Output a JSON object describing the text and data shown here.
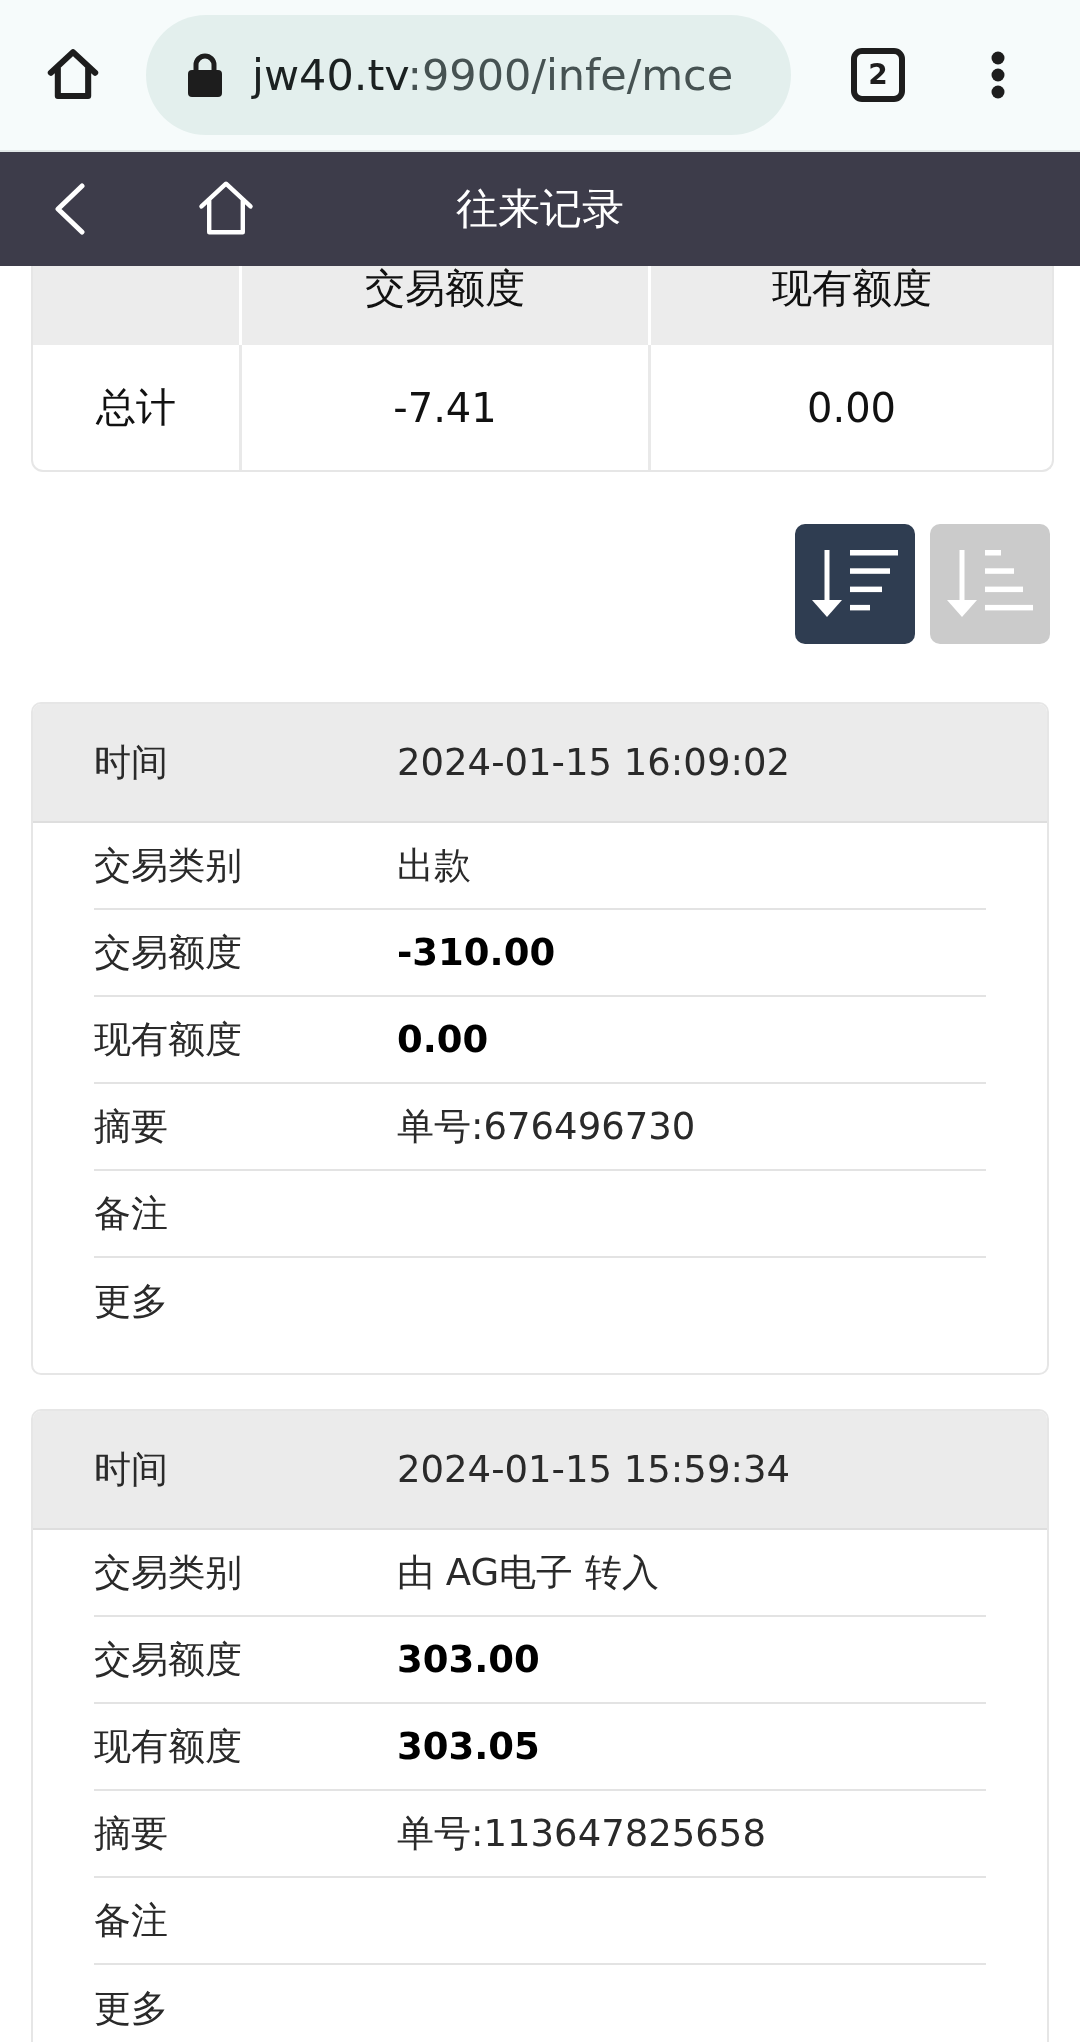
{
  "browser": {
    "url": {
      "host": "jw40.tv",
      "path": ":9900/infe/mce"
    },
    "tab_count": "2"
  },
  "header": {
    "title": "往来记录"
  },
  "summary": {
    "columns": [
      "交易额度",
      "现有额度"
    ],
    "rows": [
      {
        "label": "总计",
        "values": [
          "-7.41",
          "0.00"
        ]
      }
    ]
  },
  "sort_buttons": [
    {
      "kind": "descending",
      "selected": true
    },
    {
      "kind": "ascending",
      "selected": false
    }
  ],
  "records": [
    {
      "time_label": "时间",
      "time": "2024-01-15 16:09:02",
      "fields": [
        {
          "kind": "text",
          "label": "交易类别",
          "value": "出款"
        },
        {
          "kind": "amount",
          "label": "交易额度",
          "value": "-310.00"
        },
        {
          "kind": "amount",
          "label": "现有额度",
          "value": "0.00"
        },
        {
          "kind": "text",
          "label": "摘要",
          "value": "单号:676496730"
        },
        {
          "kind": "text",
          "label": "备注"
        },
        {
          "kind": "text",
          "label": "更多"
        }
      ]
    },
    {
      "time_label": "时间",
      "time": "2024-01-15 15:59:34",
      "fields": [
        {
          "kind": "text",
          "label": "交易类别",
          "value": "由 AG电子 转入"
        },
        {
          "kind": "amount",
          "label": "交易额度",
          "value": "303.00"
        },
        {
          "kind": "amount",
          "label": "现有额度",
          "value": "303.05"
        },
        {
          "kind": "text",
          "label": "摘要",
          "value": "单号:113647825658"
        },
        {
          "kind": "text",
          "label": "备注"
        },
        {
          "kind": "text",
          "label": "更多"
        }
      ]
    }
  ]
}
